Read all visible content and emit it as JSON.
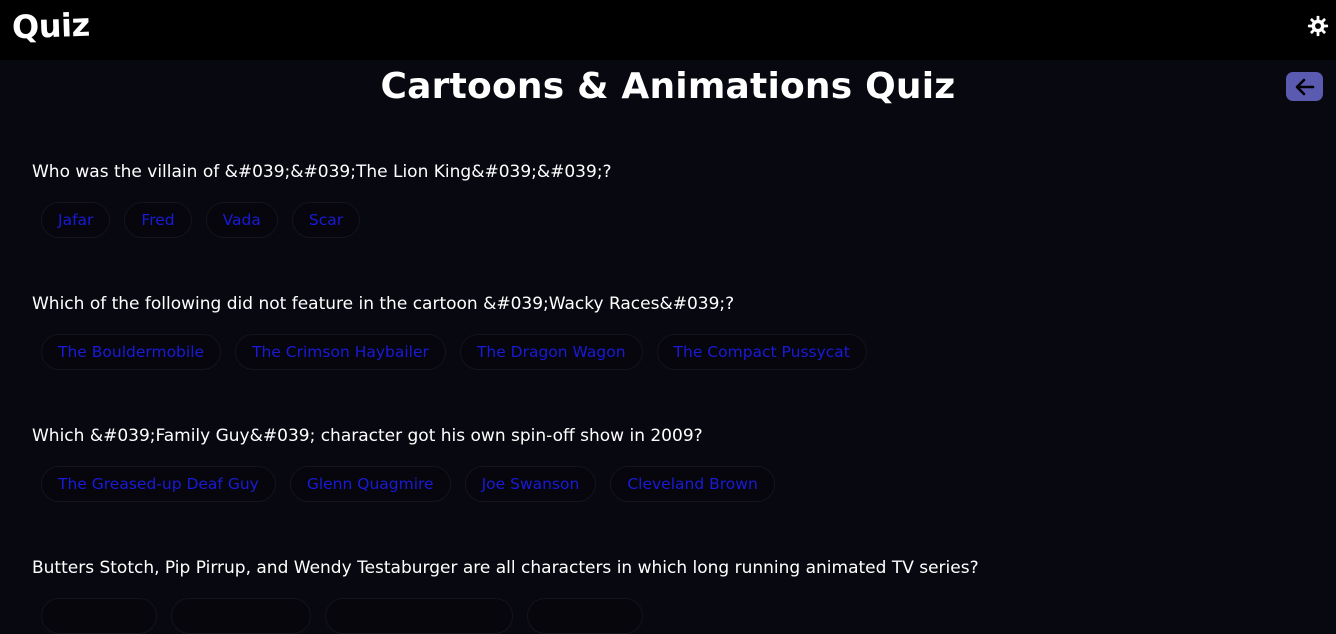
{
  "header": {
    "logo": "Quiz",
    "theme_icon": "gear-icon"
  },
  "page": {
    "title": "Cartoons & Animations Quiz",
    "back_icon": "arrow-left-icon"
  },
  "questions": [
    {
      "text": "Who was the villain of &#039;&#039;The Lion King&#039;&#039;?",
      "answers": [
        "Jafar",
        "Fred",
        "Vada",
        "Scar"
      ]
    },
    {
      "text": "Which of the following did not feature in the cartoon &#039;Wacky Races&#039;?",
      "answers": [
        "The Bouldermobile",
        "The Crimson Haybailer",
        "The Dragon Wagon",
        "The Compact Pussycat"
      ]
    },
    {
      "text": "Which &#039;Family Guy&#039; character got his own spin-off show in 2009?",
      "answers": [
        "The Greased-up Deaf Guy",
        "Glenn Quagmire",
        "Joe Swanson",
        "Cleveland Brown"
      ]
    },
    {
      "text": "Butters Stotch, Pip Pirrup, and Wendy Testaburger are all characters in which long running animated TV series?",
      "answers": [
        "",
        "",
        "",
        ""
      ]
    }
  ],
  "colors": {
    "background": "#080810",
    "topbar": "#000000",
    "answer_text": "#1a1ad8",
    "back_button": "#5a5ab0"
  }
}
